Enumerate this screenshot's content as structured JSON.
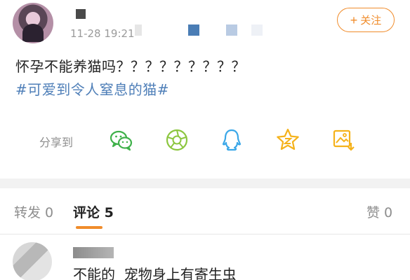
{
  "post": {
    "timestamp": "11-28 19:21",
    "follow_label": "关注",
    "follow_plus": "+",
    "text": "怀孕不能养猫吗？？？？？？？？？",
    "topic": "#可爱到令人窒息的猫#"
  },
  "share": {
    "label": "分享到",
    "targets": [
      "wechat-icon",
      "moments-icon",
      "qq-icon",
      "qzone-icon",
      "save-image-icon"
    ]
  },
  "tabs": {
    "repost": "转发 0",
    "comments": "评论 5",
    "likes": "赞 0"
  },
  "comments": [
    {
      "text": "不能的  宠物身上有寄生虫"
    }
  ],
  "colors": {
    "accent": "#f08c2b",
    "topic": "#4f7fb8",
    "wechat": "#3fb14a",
    "qq": "#3aa7e8",
    "qzone": "#f5b21b"
  }
}
